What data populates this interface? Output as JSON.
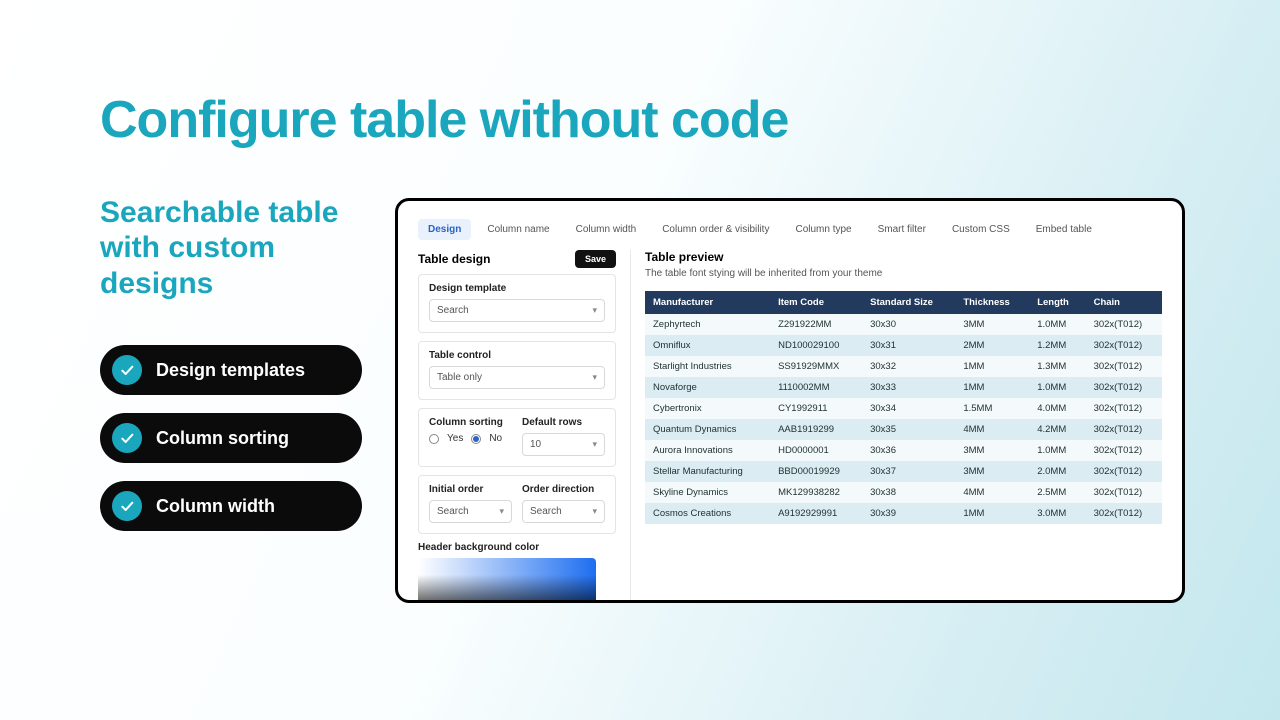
{
  "headline": "Configure table without code",
  "subhead": "Searchable table with custom designs",
  "features": [
    "Design templates",
    "Column sorting",
    "Column width"
  ],
  "app": {
    "tabs": [
      "Design",
      "Column name",
      "Column width",
      "Column order & visibility",
      "Column type",
      "Smart filter",
      "Custom CSS",
      "Embed table"
    ],
    "active_tab": 0,
    "design": {
      "title": "Table design",
      "save_label": "Save",
      "template_label": "Design template",
      "template_value": "Search",
      "table_control_label": "Table control",
      "table_control_value": "Table only",
      "column_sorting_label": "Column sorting",
      "column_sorting_yes": "Yes",
      "column_sorting_no": "No",
      "column_sorting_value": "No",
      "default_rows_label": "Default rows",
      "default_rows_value": "10",
      "initial_order_label": "Initial order",
      "initial_order_value": "Search",
      "order_direction_label": "Order direction",
      "order_direction_value": "Search",
      "header_bg_label": "Header background color"
    },
    "preview": {
      "title": "Table preview",
      "note": "The table font stying will be inherited from your theme",
      "columns": [
        "Manufacturer",
        "Item Code",
        "Standard Size",
        "Thickness",
        "Length",
        "Chain"
      ],
      "rows": [
        [
          "Zephyrtech",
          "Z291922MM",
          "30x30",
          "3MM",
          "1.0MM",
          "302x(T012)"
        ],
        [
          "Omniflux",
          "ND100029100",
          "30x31",
          "2MM",
          "1.2MM",
          "302x(T012)"
        ],
        [
          "Starlight Industries",
          "SS91929MMX",
          "30x32",
          "1MM",
          "1.3MM",
          "302x(T012)"
        ],
        [
          "Novaforge",
          "1110002MM",
          "30x33",
          "1MM",
          "1.0MM",
          "302x(T012)"
        ],
        [
          "Cybertronix",
          "CY1992911",
          "30x34",
          "1.5MM",
          "4.0MM",
          "302x(T012)"
        ],
        [
          "Quantum Dynamics",
          "AAB1919299",
          "30x35",
          "4MM",
          "4.2MM",
          "302x(T012)"
        ],
        [
          "Aurora Innovations",
          "HD0000001",
          "30x36",
          "3MM",
          "1.0MM",
          "302x(T012)"
        ],
        [
          "Stellar Manufacturing",
          "BBD00019929",
          "30x37",
          "3MM",
          "2.0MM",
          "302x(T012)"
        ],
        [
          "Skyline Dynamics",
          "MK129938282",
          "30x38",
          "4MM",
          "2.5MM",
          "302x(T012)"
        ],
        [
          "Cosmos Creations",
          "A9192929991",
          "30x39",
          "1MM",
          "3.0MM",
          "302x(T012)"
        ]
      ]
    }
  }
}
